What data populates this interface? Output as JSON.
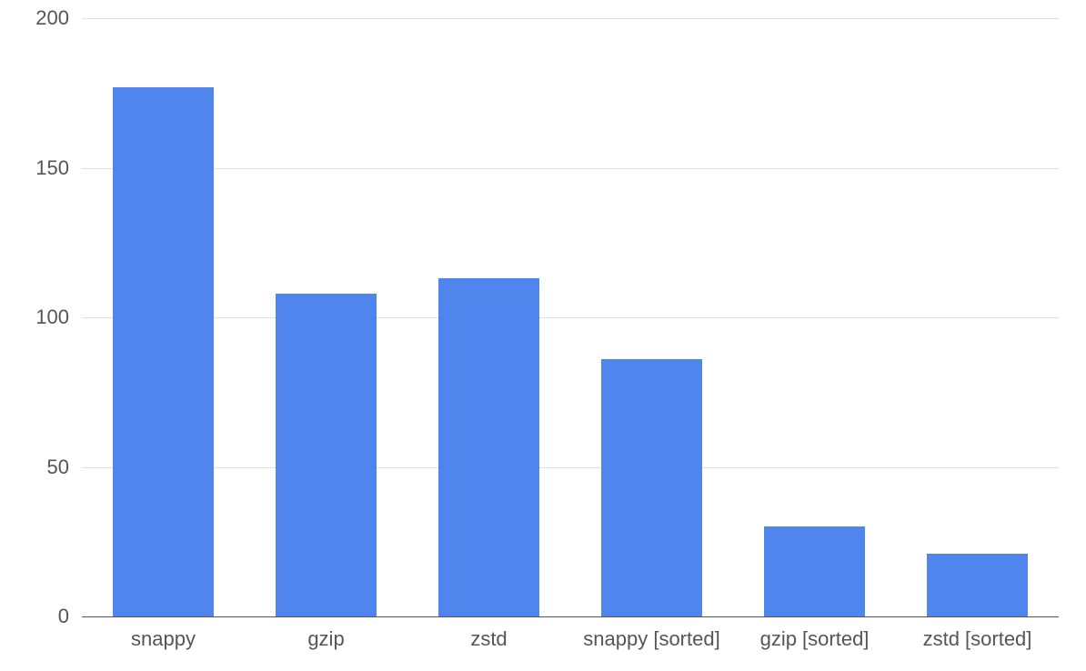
{
  "chart_data": {
    "type": "bar",
    "categories": [
      "snappy",
      "gzip",
      "zstd",
      "snappy [sorted]",
      "gzip [sorted]",
      "zstd [sorted]"
    ],
    "values": [
      177,
      108,
      113,
      86,
      30,
      21
    ],
    "title": "",
    "xlabel": "",
    "ylabel": "",
    "ylim": [
      0,
      200
    ],
    "y_ticks": [
      0,
      50,
      100,
      150,
      200
    ],
    "bar_color": "#4f85ed",
    "grid_color": "#e0e0e0"
  }
}
